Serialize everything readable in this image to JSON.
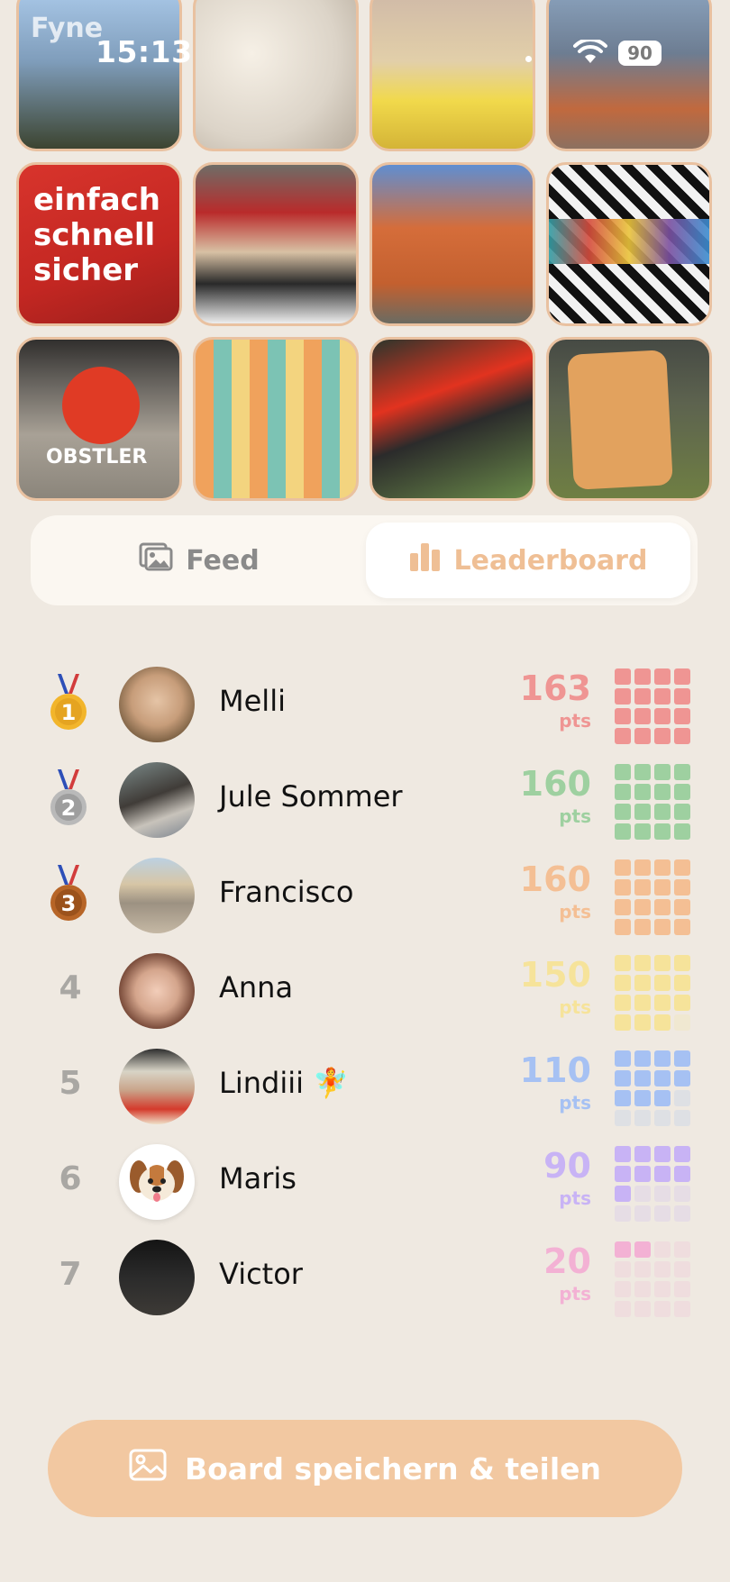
{
  "status_bar": {
    "time": "15:13",
    "battery": "90",
    "app_watermark": "Fyne"
  },
  "photo_tiles": [
    {
      "id": "photo-1",
      "label": ""
    },
    {
      "id": "photo-2",
      "label": ""
    },
    {
      "id": "photo-3",
      "label": ""
    },
    {
      "id": "photo-4",
      "label": ""
    },
    {
      "id": "photo-5",
      "label": "einfach\nschnell\nsicher"
    },
    {
      "id": "photo-6",
      "label": ""
    },
    {
      "id": "photo-7",
      "label": ""
    },
    {
      "id": "photo-8",
      "label": ""
    },
    {
      "id": "photo-9",
      "label": "OBSTLER"
    },
    {
      "id": "photo-10",
      "label": ""
    },
    {
      "id": "photo-11",
      "label": ""
    },
    {
      "id": "photo-12",
      "label": ""
    }
  ],
  "tabs": {
    "feed": "Feed",
    "leaderboard": "Leaderboard",
    "active": "leaderboard"
  },
  "leaderboard": [
    {
      "rank": "1",
      "medal": "gold",
      "name": "Melli",
      "points": "163",
      "unit": "pts",
      "color": "#ef9593",
      "progress": 1.0
    },
    {
      "rank": "2",
      "medal": "silver",
      "name": "Jule Sommer",
      "points": "160",
      "unit": "pts",
      "color": "#9ed0a0",
      "progress": 1.0
    },
    {
      "rank": "3",
      "medal": "bronze",
      "name": "Francisco",
      "points": "160",
      "unit": "pts",
      "color": "#f4bf94",
      "progress": 1.0
    },
    {
      "rank": "4",
      "medal": "",
      "name": "Anna",
      "points": "150",
      "unit": "pts",
      "color": "#f6e39a",
      "progress": 0.94
    },
    {
      "rank": "5",
      "medal": "",
      "name": "Lindiii 🧚",
      "points": "110",
      "unit": "pts",
      "color": "#a6c1f3",
      "progress": 0.69
    },
    {
      "rank": "6",
      "medal": "",
      "name": "Maris",
      "points": "90",
      "unit": "pts",
      "color": "#c8b3f5",
      "progress": 0.56
    },
    {
      "rank": "7",
      "medal": "",
      "name": "Victor",
      "points": "20",
      "unit": "pts",
      "color": "#f3b1d4",
      "progress": 0.13
    }
  ],
  "cta": {
    "label": "Board speichern & teilen"
  },
  "colors": {
    "accent": "#f2c8a1",
    "background": "#efe9e1"
  }
}
